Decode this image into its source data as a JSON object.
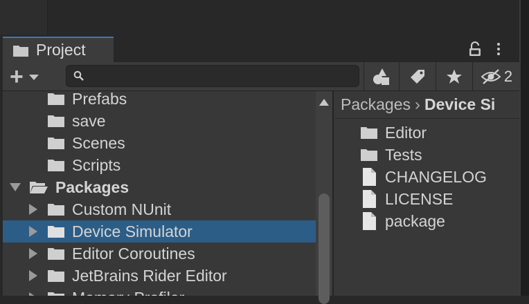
{
  "project_panel": {
    "tab_title": "Project",
    "hidden_count": "2"
  },
  "tree": {
    "items": [
      {
        "label": "Prefabs"
      },
      {
        "label": "save"
      },
      {
        "label": "Scenes"
      },
      {
        "label": "Scripts"
      },
      {
        "label": "Packages"
      },
      {
        "label": "Custom NUnit"
      },
      {
        "label": "Device Simulator"
      },
      {
        "label": "Editor Coroutines"
      },
      {
        "label": "JetBrains Rider Editor"
      },
      {
        "label": "Memory Profiler"
      }
    ]
  },
  "breadcrumb": {
    "root": "Packages",
    "separator": "›",
    "current": "Device Si"
  },
  "contents": {
    "items": [
      {
        "label": "Editor",
        "icon": "folder-icon"
      },
      {
        "label": "Tests",
        "icon": "folder-icon"
      },
      {
        "label": "CHANGELOG",
        "icon": "file-icon"
      },
      {
        "label": "LICENSE",
        "icon": "file-icon"
      },
      {
        "label": "package",
        "icon": "file-icon"
      }
    ]
  },
  "colors": {
    "selection": "#2c5d87",
    "tab_accent": "#3a79bb",
    "panel_bg": "#383838"
  }
}
